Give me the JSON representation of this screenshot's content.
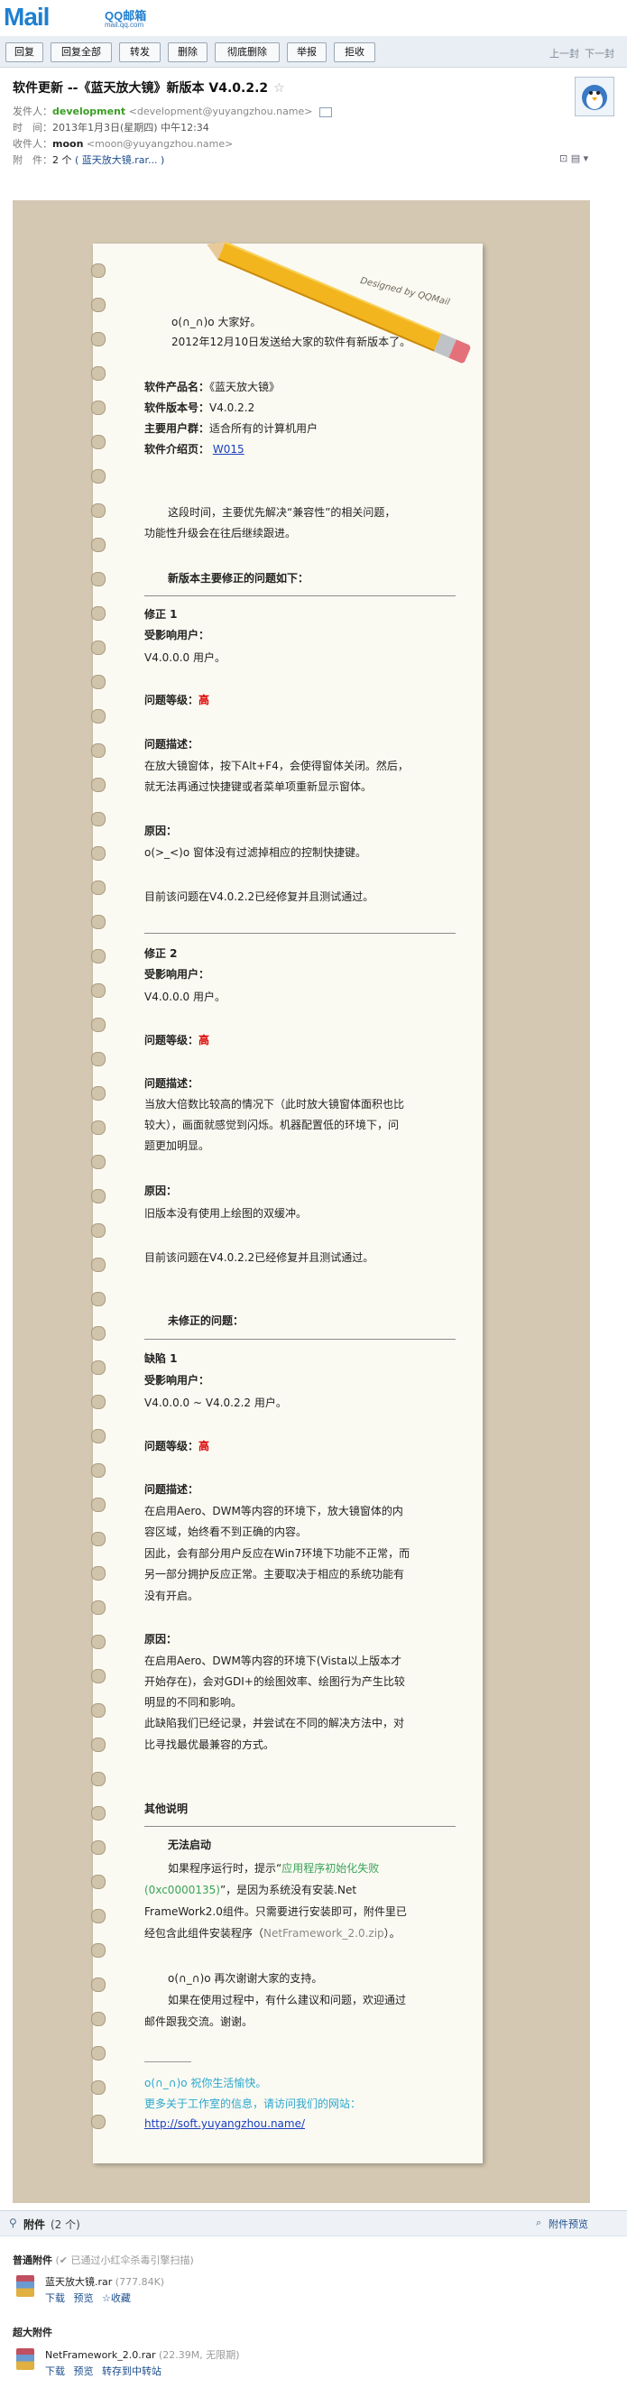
{
  "app": {
    "logo": "Mail",
    "logo_cn": "QQ邮箱",
    "logo_domain": "mail.qq.com"
  },
  "toolbar": {
    "buttons": [
      "回复",
      "回复全部",
      "转发",
      "删除",
      "彻底删除",
      "举报",
      "拒收"
    ],
    "prev": "上一封",
    "next": "下一封"
  },
  "email": {
    "subject": "软件更新 --《蓝天放大镜》新版本 V4.0.2.2",
    "sender_label": "发件人：",
    "sender_name": "development",
    "sender_email": "<development@yuyangzhou.name>",
    "time_label": "时　间：",
    "time": "2013年1月3日(星期四) 中午12:34",
    "to_label": "收件人：",
    "to_name": "moon",
    "to_email": "<moon@yuyangzhou.name>",
    "att_label": "附　件：",
    "att_count": "2 个",
    "att_summary": "( 蓝天放大镜.rar... )"
  },
  "stationery": {
    "designed_by": "Designed by QQMail"
  },
  "body": {
    "greeting": "o(∩_∩)o  大家好。",
    "intro": "2012年12月10日发送给大家的软件有新版本了。",
    "product_label": "软件产品名：",
    "product": "《蓝天放大镜》",
    "version_label": "软件版本号：",
    "version": "V4.0.2.2",
    "users_label": "主要用户群：",
    "users": "适合所有的计算机用户",
    "page_label": "软件介绍页：",
    "page_link": "W015",
    "para1_l1": "这段时间，主要优先解决“兼容性”的相关问题，",
    "para1_l2": "功能性升级会在往后继续跟进。",
    "fix_header": "新版本主要修正的问题如下：",
    "fix1_title": "修正 1",
    "affect_label": "受影响用户：",
    "fix1_users": "V4.0.0.0  用户。",
    "level_label": "问题等级：",
    "level_high": "高",
    "desc_label": "问题描述：",
    "fix1_desc_l1": "在放大镜窗体，按下Alt+F4，会使得窗体关闭。然后，",
    "fix1_desc_l2": "就无法再通过快捷键或者菜单项重新显示窗体。",
    "cause_label": "原因：",
    "fix1_cause": "o(>_<)o 窗体没有过滤掉相应的控制快捷键。",
    "fixed_note": "目前该问题在V4.0.2.2已经修复并且测试通过。",
    "fix2_title": "修正 2",
    "fix2_users": "V4.0.0.0  用户。",
    "fix2_desc_l1": "当放大倍数比较高的情况下（此时放大镜窗体面积也比",
    "fix2_desc_l2": "较大），画面就感觉到闪烁。机器配置低的环境下，问",
    "fix2_desc_l3": "题更加明显。",
    "fix2_cause": "旧版本没有使用上绘图的双缓冲。",
    "unfixed_header": "未修正的问题：",
    "bug1_title": "缺陷 1",
    "bug1_users": "V4.0.0.0 ~ V4.0.2.2  用户。",
    "bug1_desc_l1": "在启用Aero、DWM等内容的环境下，放大镜窗体的内",
    "bug1_desc_l2": "容区域，始终看不到正确的内容。",
    "bug1_desc_l3": "因此，会有部分用户反应在Win7环境下功能不正常，而",
    "bug1_desc_l4": "另一部分拥护反应正常。主要取决于相应的系统功能有",
    "bug1_desc_l5": "没有开启。",
    "bug1_cause_l1": "在启用Aero、DWM等内容的环境下(Vista以上版本才",
    "bug1_cause_l2": "开始存在)，会对GDI+的绘图效率、绘图行为产生比较",
    "bug1_cause_l3": "明显的不同和影响。",
    "bug1_cause_l4": "此缺陷我们已经记录，并尝试在不同的解决方法中，对",
    "bug1_cause_l5": "比寻找最优最兼容的方式。",
    "other_header": "其他说明",
    "no_start": "无法启动",
    "ns_l1_a": "如果程序运行时，提示“",
    "ns_l1_b": "应用程序初始化失败",
    "ns_l2_a": "(0xc0000135)",
    "ns_l2_b": "”，是因为系统没有安装.Net",
    "ns_l3": "FrameWork2.0组件。只需要进行安装即可，附件里已",
    "ns_l4_a": "经包含此组件安装程序（",
    "ns_l4_b": "NetFramework_2.0.zip",
    "ns_l4_c": "）。",
    "thanks_l1": "o(∩_∩)o 再次谢谢大家的支持。",
    "thanks_l2": "如果在使用过程中，有什么建议和问题，欢迎通过",
    "thanks_l3": "邮件跟我交流。谢谢。",
    "sig_l1": "o(∩_∩)o  祝你生活愉快。",
    "sig_l2": "更多关于工作室的信息，请访问我们的网站：",
    "sig_link": "http://soft.yuyangzhou.name/"
  },
  "attachments": {
    "header": "附件",
    "count": "(2 个)",
    "preview": "附件预览",
    "normal_label": "普通附件",
    "normal_note": "(✔ 已通过小红伞杀毒引擎扫描)",
    "file1_name": "蓝天放大镜.rar",
    "file1_size": "(777.84K)",
    "file1_actions": [
      "下载",
      "预览",
      "☆收藏"
    ],
    "super_label": "超大附件",
    "file2_name": "NetFramework_2.0.rar",
    "file2_size": "(22.39M, 无限期)",
    "file2_actions": [
      "下载",
      "预览",
      "转存到中转站"
    ]
  },
  "colors": {
    "accent": "#1f7fd0",
    "green": "#3a9d23",
    "red": "#d00000",
    "paper": "#d4c8b2"
  }
}
